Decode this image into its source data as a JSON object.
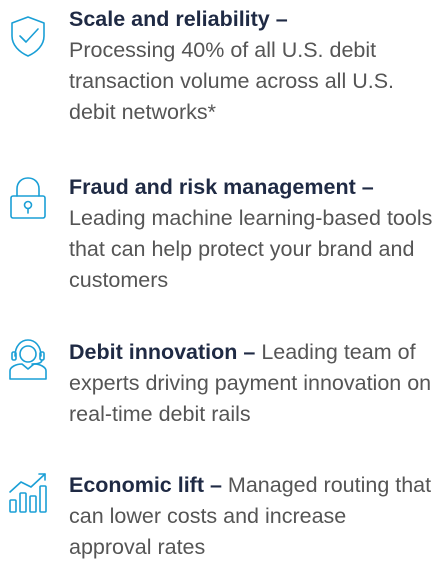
{
  "accent_color": "#1a9fd6",
  "features": [
    {
      "icon": "shield-check-icon",
      "title": "Scale and reliability",
      "separator": " –",
      "description": "Processing 40% of all U.S. debit transaction volume across all U.S. debit networks*"
    },
    {
      "icon": "padlock-icon",
      "title": "Fraud and risk management",
      "separator": " –",
      "description": "Leading machine learning-based tools that can help protect your brand and customers"
    },
    {
      "icon": "headset-agent-icon",
      "title": "Debit innovation",
      "separator": " –",
      "description": "Leading team of experts driving payment innovation on real-time debit rails"
    },
    {
      "icon": "growth-chart-icon",
      "title": "Economic lift",
      "separator": " –",
      "description": "Managed routing that can lower costs and increase approval rates"
    }
  ]
}
